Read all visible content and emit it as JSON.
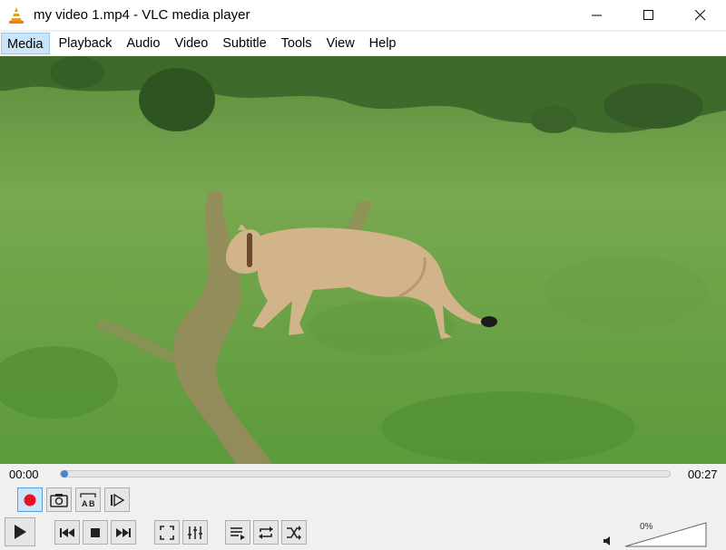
{
  "window": {
    "title": "my video 1.mp4 - VLC media player"
  },
  "menu": [
    "Media",
    "Playback",
    "Audio",
    "Video",
    "Subtitle",
    "Tools",
    "View",
    "Help"
  ],
  "player": {
    "elapsed": "00:00",
    "total": "00:27",
    "progress": 0,
    "volume_label": "0%",
    "volume": 0
  },
  "icons": {
    "record": "record-icon",
    "snapshot": "camera-icon",
    "loop_ab": "loop-ab-icon",
    "frame": "frame-step-icon",
    "play": "play-icon",
    "prev": "previous-icon",
    "stop": "stop-icon",
    "next": "next-icon",
    "fullscreen": "fullscreen-icon",
    "effects": "equalizer-icon",
    "playlist": "playlist-icon",
    "loop": "loop-icon",
    "shuffle": "shuffle-icon",
    "speaker": "speaker-icon"
  },
  "colors": {
    "record": "#e81123",
    "seek_knob": "#4a83d4",
    "active_menu": "#cce4f7"
  }
}
